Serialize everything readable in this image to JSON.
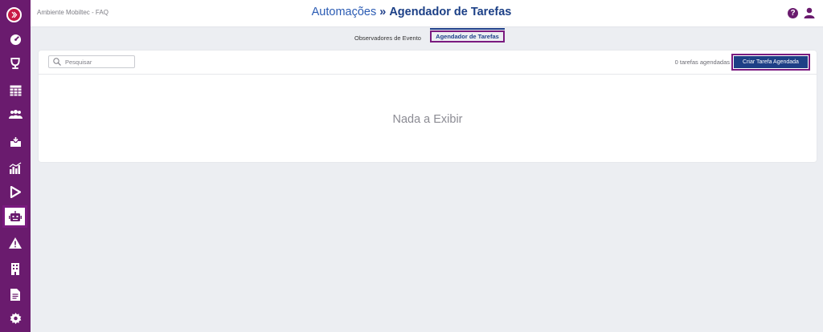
{
  "header": {
    "environment": "Ambiente Mobiltec - FAQ",
    "title_section": "Automações",
    "title_separator": "»",
    "title_current": "Agendador de Tarefas"
  },
  "sidebar": {
    "items": [
      {
        "name": "tachometer-icon"
      },
      {
        "name": "trophy-icon"
      },
      {
        "name": "table-icon"
      },
      {
        "name": "users-icon"
      },
      {
        "name": "inbox-icon"
      },
      {
        "name": "chart-icon"
      },
      {
        "name": "play-icon"
      },
      {
        "name": "robot-icon",
        "active": true
      },
      {
        "name": "warning-icon"
      },
      {
        "name": "building-icon"
      },
      {
        "name": "document-icon"
      },
      {
        "name": "gear-icon"
      }
    ]
  },
  "tabs": [
    {
      "label": "Observadores de Evento",
      "active": false
    },
    {
      "label": "Agendador de Tarefas",
      "active": true
    }
  ],
  "toolbar": {
    "search_placeholder": "Pesquisar",
    "task_count": "0 tarefas agendadas",
    "create_button": "Criar Tarefa Agendada"
  },
  "empty_message": "Nada a Exibir",
  "colors": {
    "sidebar": "#6a1b6e",
    "highlight": "#7a1a7f",
    "primary": "#1e3f86",
    "logo": "#c81a45"
  }
}
